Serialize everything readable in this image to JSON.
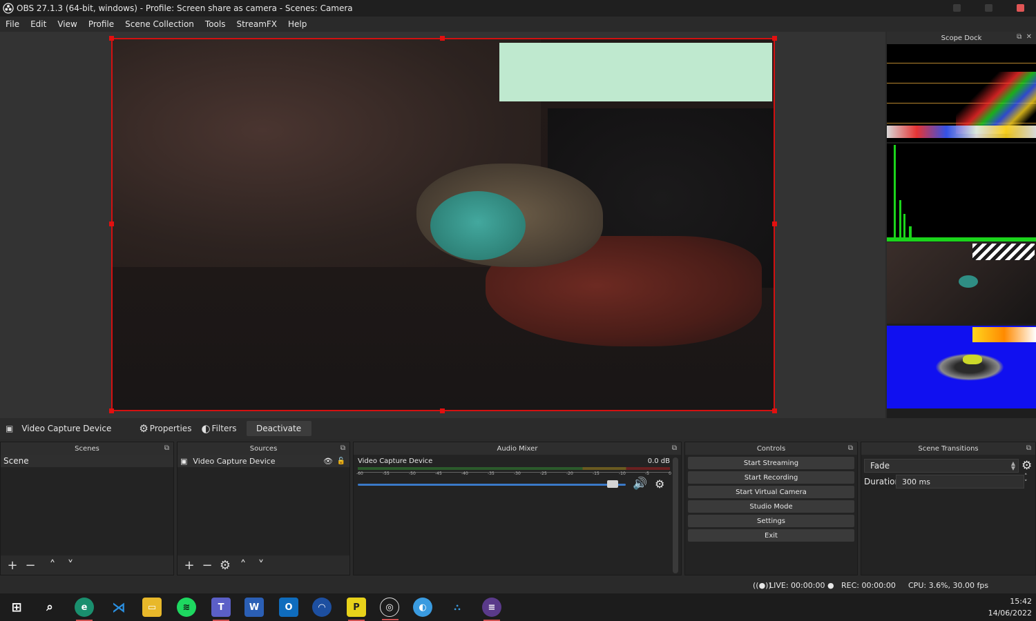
{
  "window": {
    "title": "OBS 27.1.3 (64-bit, windows) - Profile: Screen share as camera - Scenes: Camera"
  },
  "menu": [
    "File",
    "Edit",
    "View",
    "Profile",
    "Scene Collection",
    "Tools",
    "StreamFX",
    "Help"
  ],
  "scope_dock": {
    "title": "Scope Dock"
  },
  "source_toolbar": {
    "source_name": "Video Capture Device",
    "properties": "Properties",
    "filters": "Filters",
    "deactivate": "Deactivate"
  },
  "scenes": {
    "title": "Scenes",
    "items": [
      "Scene"
    ]
  },
  "sources": {
    "title": "Sources",
    "items": [
      "Video Capture Device"
    ]
  },
  "mixer": {
    "title": "Audio Mixer",
    "channel": "Video Capture Device",
    "level": "0.0 dB",
    "ticks": [
      "-60",
      "-55",
      "-50",
      "-45",
      "-40",
      "-35",
      "-30",
      "-25",
      "-20",
      "-15",
      "-10",
      "-5",
      "0"
    ],
    "volume": 0.95
  },
  "controls": {
    "title": "Controls",
    "buttons": [
      "Start Streaming",
      "Start Recording",
      "Start Virtual Camera",
      "Studio Mode",
      "Settings",
      "Exit"
    ]
  },
  "transitions": {
    "title": "Scene Transitions",
    "selected": "Fade",
    "duration_label": "Duration",
    "duration_value": "300 ms"
  },
  "status": {
    "live": "LIVE: 00:00:00",
    "rec": "REC: 00:00:00",
    "cpu": "CPU: 3.6%, 30.00 fps"
  },
  "taskbar": {
    "time": "15:42",
    "date": "14/06/2022"
  },
  "colors": {
    "selection": "#d41010",
    "accent": "#3a79c8"
  }
}
